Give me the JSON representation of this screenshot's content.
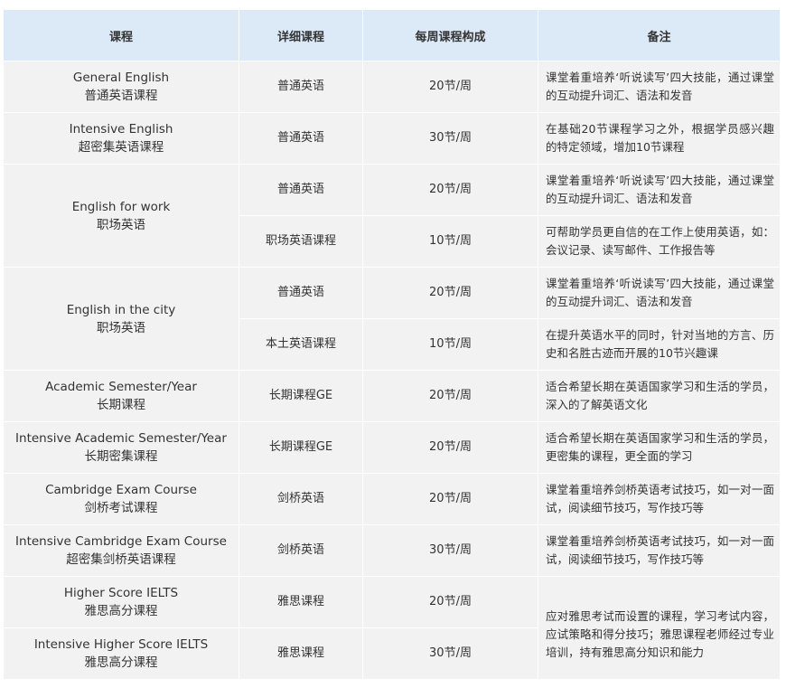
{
  "headers": {
    "course": "课程",
    "detail": "详细课程",
    "weekly": "每周课程构成",
    "note": "备注"
  },
  "rows": {
    "r1": {
      "course_en": "General English",
      "course_cn": "普通英语课程",
      "detail": "普通英语",
      "weekly": "20节/周",
      "note": "课堂着重培养‘听说读写’四大技能，通过课堂的互动提升词汇、语法和发音"
    },
    "r2": {
      "course_en": "Intensive English",
      "course_cn": "超密集英语课程",
      "detail": "普通英语",
      "weekly": "30节/周",
      "note": "在基础20节课程学习之外，根据学员感兴趣的特定领域，增加10节课程"
    },
    "r3": {
      "course_en": "English for work",
      "course_cn": "职场英语",
      "detail": "普通英语",
      "weekly": "20节/周",
      "note": "课堂着重培养‘听说读写’四大技能，通过课堂的互动提升词汇、语法和发音"
    },
    "r4": {
      "detail": "职场英语课程",
      "weekly": "10节/周",
      "note": "可帮助学员更自信的在工作上使用英语，如：会议记录、读写邮件、工作报告等"
    },
    "r5": {
      "course_en": "English in the city",
      "course_cn": "职场英语",
      "detail": "普通英语",
      "weekly": "20节/周",
      "note": "课堂着重培养‘听说读写’四大技能，通过课堂的互动提升词汇、语法和发音"
    },
    "r6": {
      "detail": "本土英语课程",
      "weekly": "10节/周",
      "note": "在提升英语水平的同时，针对当地的方言、历史和名胜古迹而开展的10节兴趣课"
    },
    "r7": {
      "course_en": "Academic Semester/Year",
      "course_cn": "长期课程",
      "detail": "长期课程GE",
      "weekly": "20节/周",
      "note": "适合希望长期在英语国家学习和生活的学员，深入的了解英语文化"
    },
    "r8": {
      "course_en": "Intensive Academic Semester/Year",
      "course_cn": "长期密集课程",
      "detail": "长期课程GE",
      "weekly": "20节/周",
      "note": "适合希望长期在英语国家学习和生活的学员，更密集的课程，更全面的学习"
    },
    "r9": {
      "course_en": "Cambridge Exam Course",
      "course_cn": "剑桥考试课程",
      "detail": "剑桥英语",
      "weekly": "20节/周",
      "note": "课堂着重培养剑桥英语考试技巧，如一对一面试，阅读细节技巧，写作技巧等"
    },
    "r10": {
      "course_en": "Intensive Cambridge Exam Course",
      "course_cn": "超密集剑桥英语课程",
      "detail": "剑桥英语",
      "weekly": "30节/周",
      "note": "课堂着重培养剑桥英语考试技巧，如一对一面试，阅读细节技巧，写作技巧等"
    },
    "r11": {
      "course_en": "Higher Score IELTS",
      "course_cn": "雅思高分课程",
      "detail": "雅思课程",
      "weekly": "20节/周",
      "note": "应对雅思考试而设置的课程，学习考试内容，应试策略和得分技巧；雅思课程老师经过专业培训，持有雅思高分知识和能力"
    },
    "r12": {
      "course_en": "Intensive Higher Score IELTS",
      "course_cn": "雅思高分课程",
      "detail": "雅思课程",
      "weekly": "30节/周"
    }
  }
}
